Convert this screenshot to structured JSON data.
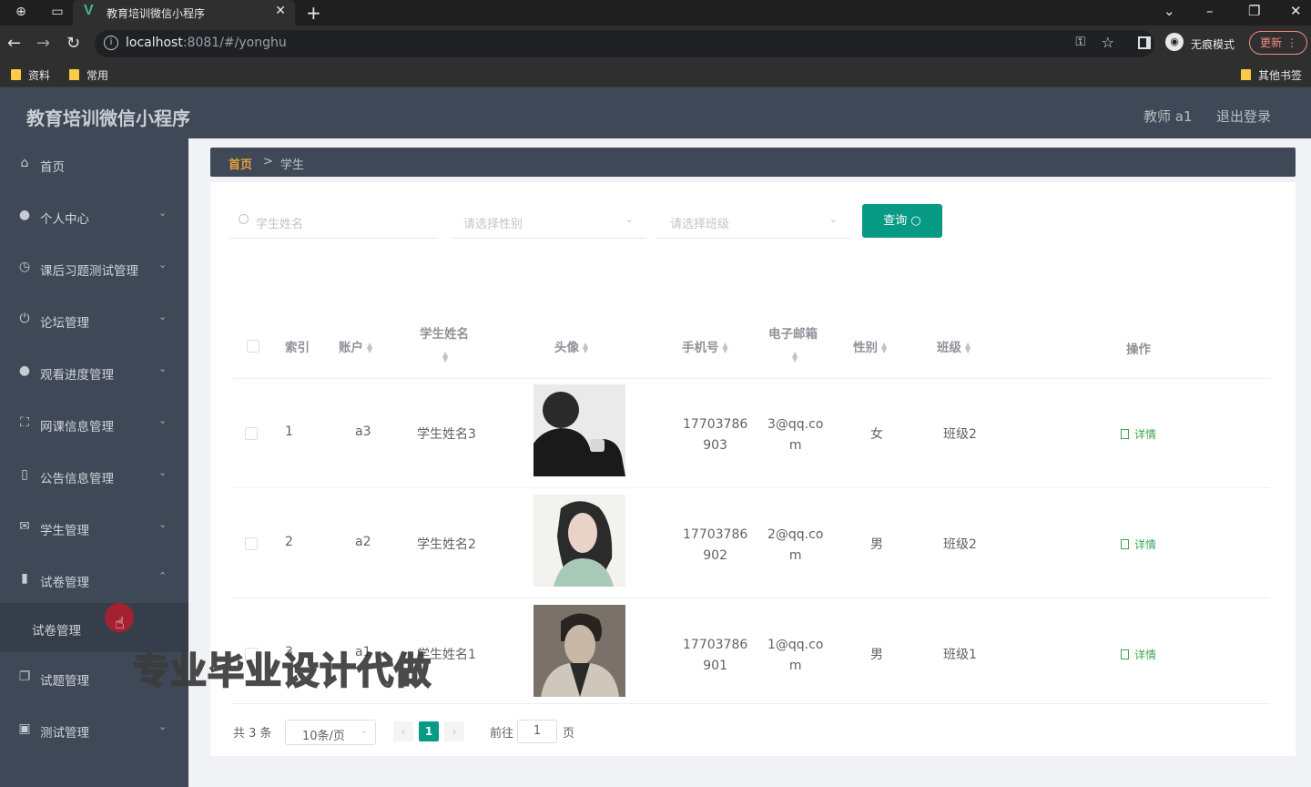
{
  "browser": {
    "tab_title": "教育培训微信小程序",
    "url_host": "localhost",
    "url_rest": ":8081/#/yonghu",
    "incognito_label": "无痕模式",
    "update_label": "更新",
    "bookmarks": [
      "资料",
      "常用"
    ],
    "other_bookmarks": "其他书签"
  },
  "app": {
    "title": "教育培训微信小程序",
    "user": "教师 a1",
    "logout": "退出登录"
  },
  "sidebar": {
    "items": [
      {
        "label": "首页",
        "icon": "home-icon"
      },
      {
        "label": "个人中心",
        "icon": "person-icon"
      },
      {
        "label": "课后习题测试管理",
        "icon": "clock-icon"
      },
      {
        "label": "论坛管理",
        "icon": "power-icon"
      },
      {
        "label": "观看进度管理",
        "icon": "user-icon"
      },
      {
        "label": "网课信息管理",
        "icon": "fullscreen-icon"
      },
      {
        "label": "公告信息管理",
        "icon": "phone-icon"
      },
      {
        "label": "学生管理",
        "icon": "mail-icon"
      },
      {
        "label": "试卷管理",
        "icon": "chart-icon"
      },
      {
        "label": "试题管理",
        "icon": "copy-icon"
      },
      {
        "label": "测试管理",
        "icon": "calendar-icon"
      }
    ],
    "submenu_label": "试卷管理"
  },
  "breadcrumb": {
    "home": "首页",
    "sep": ">",
    "current": "学生"
  },
  "search": {
    "name_placeholder": "学生姓名",
    "gender_placeholder": "请选择性别",
    "class_placeholder": "请选择班级",
    "query_label": "查询"
  },
  "table": {
    "headers": {
      "index": "索引",
      "account": "账户",
      "name": "学生姓名",
      "avatar": "头像",
      "phone": "手机号",
      "email": "电子邮箱",
      "gender": "性别",
      "class": "班级",
      "action": "操作"
    },
    "rows": [
      {
        "index": "1",
        "account": "a3",
        "name": "学生姓名3",
        "phone_1": "17703786",
        "phone_2": "903",
        "email_1": "3@qq.co",
        "email_2": "m",
        "gender": "女",
        "class": "班级2",
        "action": "详情"
      },
      {
        "index": "2",
        "account": "a2",
        "name": "学生姓名2",
        "phone_1": "17703786",
        "phone_2": "902",
        "email_1": "2@qq.co",
        "email_2": "m",
        "gender": "男",
        "class": "班级2",
        "action": "详情"
      },
      {
        "index": "3",
        "account": "a1",
        "name": "学生姓名1",
        "phone_1": "17703786",
        "phone_2": "901",
        "email_1": "1@qq.co",
        "email_2": "m",
        "gender": "男",
        "class": "班级1",
        "action": "详情"
      }
    ]
  },
  "pager": {
    "total": "共 3 条",
    "page_size": "10条/页",
    "current": "1",
    "goto_prefix": "前往",
    "goto_value": "1",
    "goto_suffix": "页"
  },
  "watermark": "专业毕业设计代做",
  "colors": {
    "accent": "#079a84",
    "header": "#3e4856",
    "breadcrumb_home": "#e6a23c",
    "detail": "#3da556"
  }
}
